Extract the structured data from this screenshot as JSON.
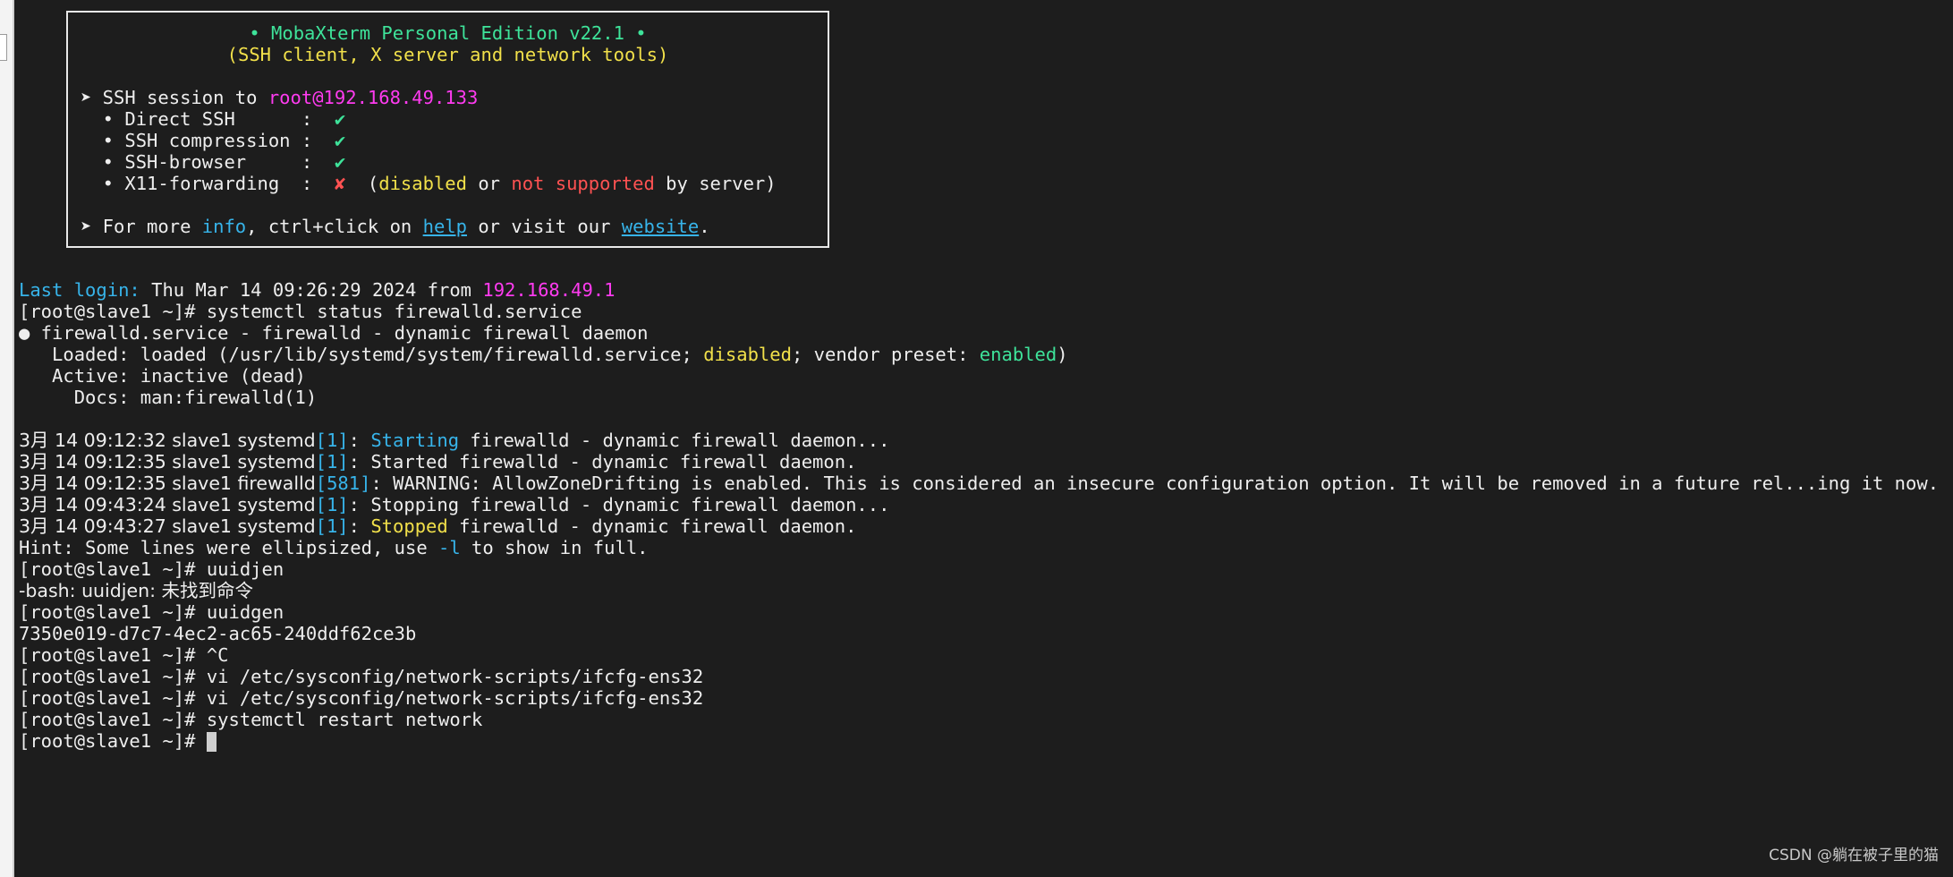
{
  "banner": {
    "title": "• MobaXterm Personal Edition v22.1 •",
    "subtitle": "(SSH client, X server and network tools)",
    "session_prefix": "➤ SSH session to ",
    "session_target": "root@192.168.49.133",
    "rows": [
      {
        "label": "  • Direct SSH      :  ",
        "mark": "✔"
      },
      {
        "label": "  • SSH compression :  ",
        "mark": "✔"
      },
      {
        "label": "  • SSH-browser     :  ",
        "mark": "✔"
      }
    ],
    "x11": {
      "label": "  • X11-forwarding  :  ",
      "mark": "✘",
      "open": "  (",
      "disabled": "disabled",
      "or": " or ",
      "not_supported": "not supported",
      "tail": " by server)"
    },
    "info_line": {
      "prefix": "➤ For more ",
      "info": "info",
      "mid1": ", ctrl+click on ",
      "help": "help",
      "mid2": " or visit our ",
      "website": "website",
      "end": "."
    }
  },
  "login": {
    "label": "Last login:",
    "text": " Thu Mar 14 09:26:29 2024 from ",
    "ip": "192.168.49.1"
  },
  "status_cmd": "[root@slave1 ~]# systemctl status firewalld.service",
  "service_line": "● firewalld.service - firewalld - dynamic firewall daemon",
  "loaded": {
    "prefix": "   Loaded: loaded (/usr/lib/systemd/system/firewalld.service; ",
    "disabled": "disabled",
    "mid": "; vendor preset: ",
    "enabled": "enabled",
    "end": ")"
  },
  "active_line": "   Active: inactive (dead)",
  "docs_line": "     Docs: man:firewalld(1)",
  "logs": [
    {
      "prefix": "3月 14 09:12:32 slave1 systemd",
      "pid": "[1]",
      "colon": ": ",
      "verb": "Starting",
      "verb_color": "cyan",
      "rest": " firewalld - dynamic firewall daemon..."
    },
    {
      "prefix": "3月 14 09:12:35 slave1 systemd",
      "pid": "[1]",
      "colon": ": ",
      "verb": "Started",
      "verb_color": "plain",
      "rest": " firewalld - dynamic firewall daemon."
    },
    {
      "prefix": "3月 14 09:12:35 slave1 firewalld",
      "pid": "[581]",
      "colon": ": ",
      "verb": "WARNING:",
      "verb_color": "plain",
      "rest": " AllowZoneDrifting is enabled. This is considered an insecure configuration option. It will be removed in a future rel...ing it now."
    },
    {
      "prefix": "3月 14 09:43:24 slave1 systemd",
      "pid": "[1]",
      "colon": ": ",
      "verb": "Stopping",
      "verb_color": "plain",
      "rest": " firewalld - dynamic firewall daemon..."
    },
    {
      "prefix": "3月 14 09:43:27 slave1 systemd",
      "pid": "[1]",
      "colon": ": ",
      "verb": "Stopped",
      "verb_color": "yellow",
      "rest": " firewalld - dynamic firewall daemon."
    }
  ],
  "hint": {
    "prefix": "Hint: Some lines were ellipsized, use ",
    "flag": "-l",
    "end": " to show in full."
  },
  "tail_lines": [
    "[root@slave1 ~]# uuidjen",
    "-bash: uuidjen: 未找到命令",
    "[root@slave1 ~]# uuidgen",
    "7350e019-d7c7-4ec2-ac65-240ddf62ce3b",
    "[root@slave1 ~]# ^C",
    "[root@slave1 ~]# vi /etc/sysconfig/network-scripts/ifcfg-ens32",
    "[root@slave1 ~]# vi /etc/sysconfig/network-scripts/ifcfg-ens32",
    "[root@slave1 ~]# systemctl restart network"
  ],
  "prompt": "[root@slave1 ~]# ",
  "watermark": "CSDN @躺在被子里的猫",
  "colors": {
    "background": "#1d1d1d",
    "green": "#3ee39a",
    "yellow": "#f1e04a",
    "magenta": "#ff3bf0",
    "cyan": "#37b4ea",
    "red": "#ff5252"
  }
}
